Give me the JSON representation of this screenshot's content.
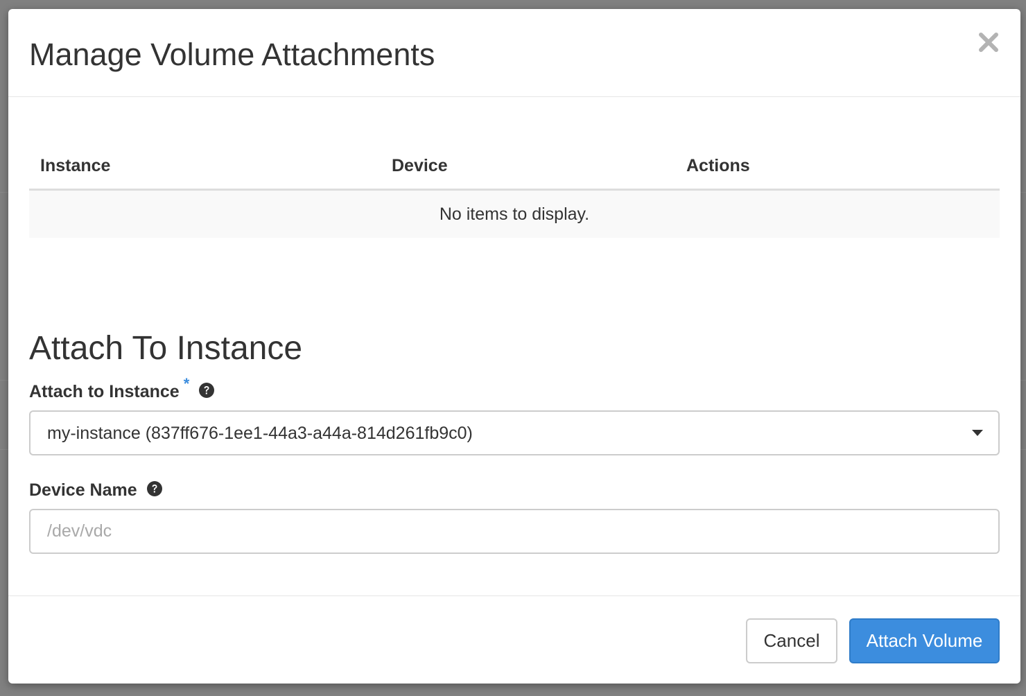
{
  "modal": {
    "title": "Manage Volume Attachments"
  },
  "attachments_table": {
    "columns": [
      "Instance",
      "Device",
      "Actions"
    ],
    "empty_message": "No items to display."
  },
  "attach_section": {
    "title": "Attach To Instance",
    "instance_field": {
      "label": "Attach to Instance",
      "required_marker": "*",
      "selected_value": "my-instance (837ff676-1ee1-44a3-a44a-814d261fb9c0)"
    },
    "device_field": {
      "label": "Device Name",
      "placeholder": "/dev/vdc",
      "value": ""
    }
  },
  "footer": {
    "cancel_label": "Cancel",
    "submit_label": "Attach Volume"
  },
  "icons": {
    "close": "close-icon",
    "help": "question-circle-icon",
    "caret": "caret-down-icon"
  },
  "colors": {
    "primary": "#3c8dde",
    "required_star": "#3c8dde",
    "backdrop": "#808080"
  }
}
